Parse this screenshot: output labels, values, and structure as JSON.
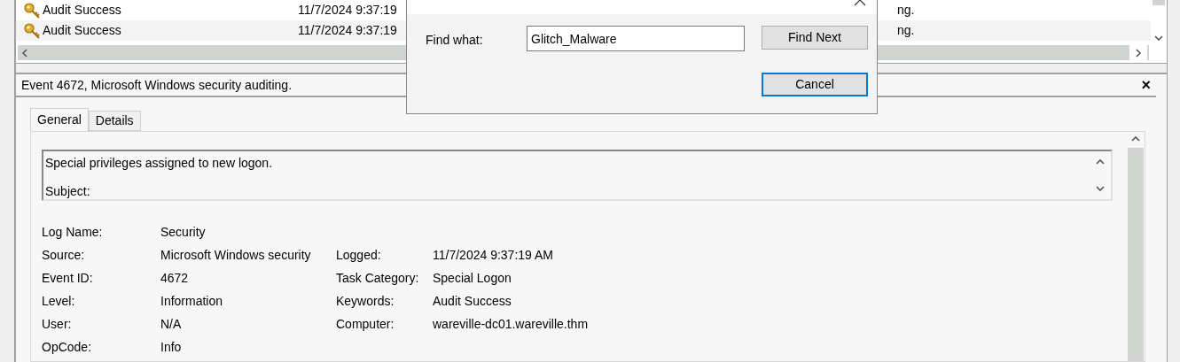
{
  "event_list": {
    "rows": [
      {
        "keywords": "Audit Success",
        "date": "11/7/2024 9:37:19",
        "column_3": "ng.",
        "selected": false
      },
      {
        "keywords": "Audit Success",
        "date": "11/7/2024 9:37:19",
        "column_3": "ng.",
        "selected": true
      }
    ]
  },
  "find_dialog": {
    "label": "Find what:",
    "value": "Glitch_Malware",
    "buttons": [
      {
        "label": "Find Next",
        "focused": false
      },
      {
        "label": "Cancel",
        "focused": true
      }
    ]
  },
  "details": {
    "title": "Event 4672, Microsoft Windows security auditing.",
    "close": "×",
    "tabs": [
      {
        "label": "General",
        "selected": true
      },
      {
        "label": "Details",
        "selected": false
      }
    ],
    "description": [
      "Special privileges assigned to new logon.",
      "Subject:"
    ],
    "fields_left": [
      {
        "label": "Log Name:",
        "value": "Security"
      },
      {
        "label": "Source:",
        "value": "Microsoft Windows security"
      },
      {
        "label": "Event ID:",
        "value": "4672"
      },
      {
        "label": "Level:",
        "value": "Information"
      },
      {
        "label": "User:",
        "value": "N/A"
      },
      {
        "label": "OpCode:",
        "value": "Info"
      }
    ],
    "fields_right": [
      {
        "label": "Logged:",
        "value": "11/7/2024 9:37:19 AM"
      },
      {
        "label": "Task Category:",
        "value": "Special Logon"
      },
      {
        "label": "Keywords:",
        "value": "Audit Success"
      },
      {
        "label": "Computer:",
        "value": "wareville-dc01.wareville.thm"
      }
    ]
  }
}
